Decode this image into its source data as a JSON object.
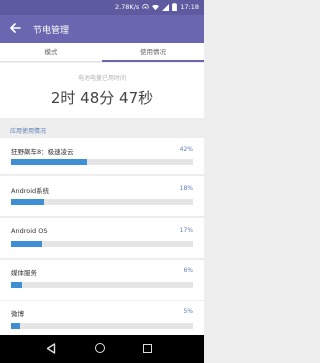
{
  "status_bar": {
    "speed": "2.78K/s",
    "time": "17:18"
  },
  "header": {
    "title": "节电管理"
  },
  "tabs": [
    {
      "label": "模式"
    },
    {
      "label": "使用情况"
    }
  ],
  "summary": {
    "label": "电池电量已用时间",
    "time": "2时 48分 47秒"
  },
  "section": {
    "title": "应用使用情况"
  },
  "apps": [
    {
      "name": "狂野飙车8：极速凌云",
      "percent_label": "42%",
      "percent": 42
    },
    {
      "name": "Android系统",
      "percent_label": "18%",
      "percent": 18
    },
    {
      "name": "Android OS",
      "percent_label": "17%",
      "percent": 17
    },
    {
      "name": "媒体服务",
      "percent_label": "6%",
      "percent": 6
    },
    {
      "name": "微博",
      "percent_label": "5%",
      "percent": 5
    }
  ],
  "colors": {
    "app_bar": "#6a67b0",
    "status_bar": "#5e5a9f",
    "accent": "#5c7fb5",
    "progress": "#3f8fd4"
  }
}
